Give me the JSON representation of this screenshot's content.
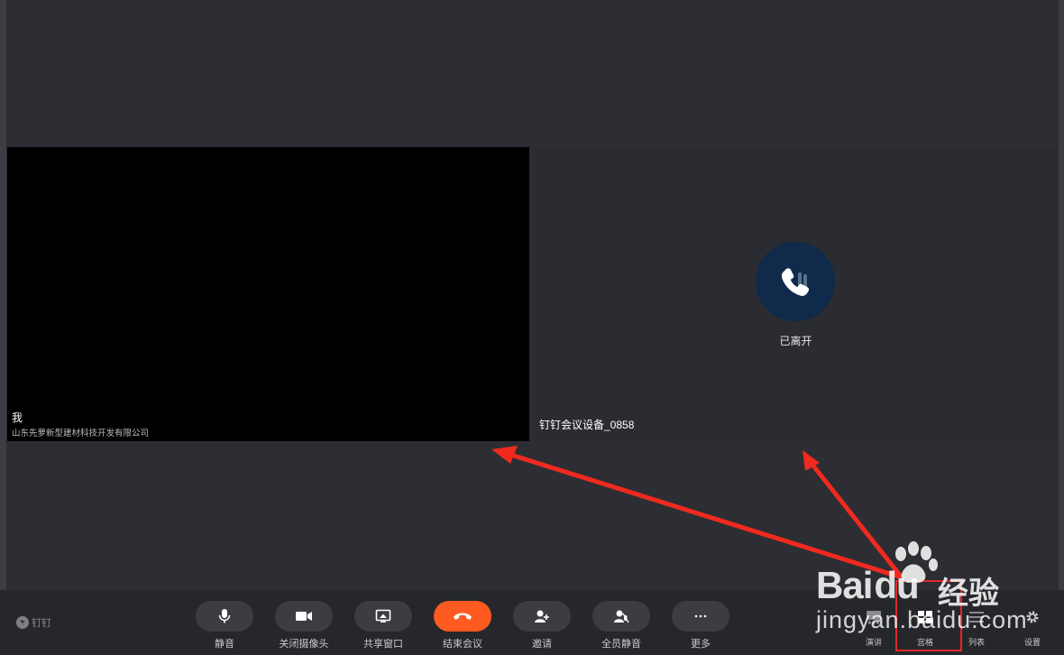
{
  "tiles": {
    "self": {
      "name": "我",
      "company": "山东先萝新型建材科技开发有限公司"
    },
    "remote": {
      "name": "钉钉会议设备_0858",
      "status": "已离开"
    }
  },
  "brand": {
    "label": "钉钉"
  },
  "toolbar": {
    "mute": "静音",
    "camera_off": "关闭摄像头",
    "share_window": "共享窗口",
    "end_meeting": "结束会议",
    "invite": "邀请",
    "mute_all": "全员静音",
    "more": "更多",
    "speaker_view": "演讲",
    "grid_view": "宫格",
    "list_view": "列表",
    "settings": "设置"
  },
  "watermark": {
    "brand": "Bai",
    "brand_suffix": "du",
    "cn": "经验",
    "url": "jingyan.baidu.com"
  },
  "colors": {
    "end_call": "#ff5a1f",
    "highlight": "#e3262a",
    "toolbar_bg": "#25272b",
    "stage_bg": "#2c2e33"
  }
}
